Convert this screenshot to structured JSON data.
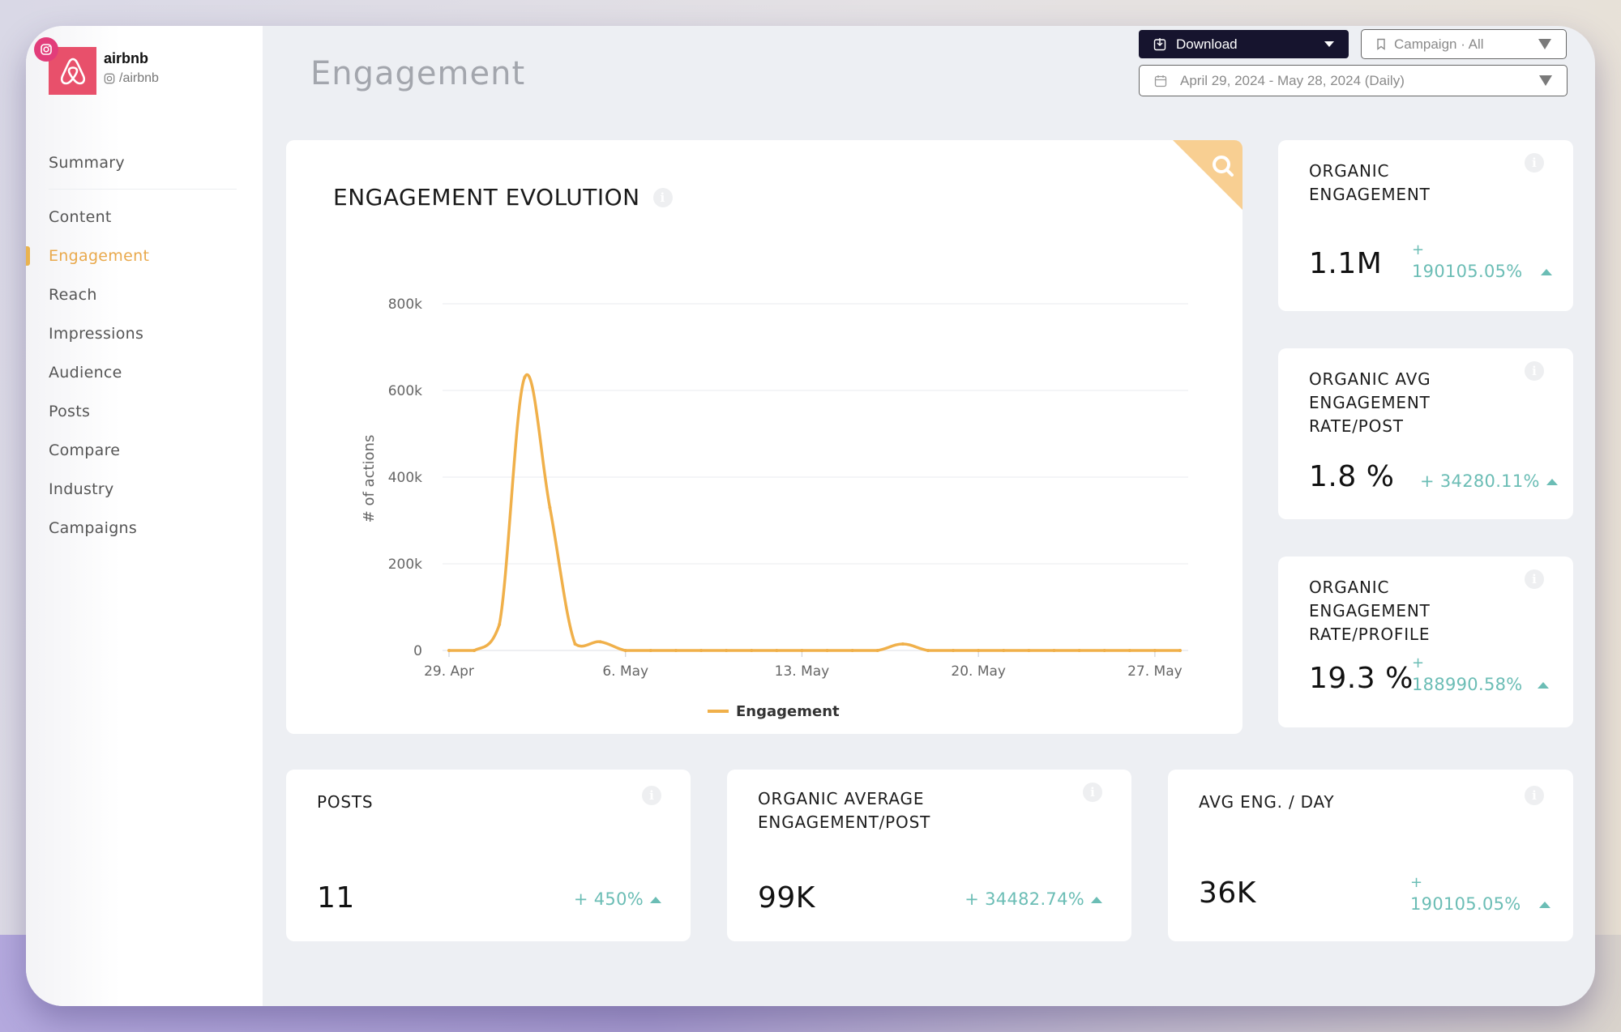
{
  "account": {
    "name": "airbnb",
    "handle": "/airbnb",
    "platform_icon": "instagram-icon",
    "brand_color": "#e8506b"
  },
  "sidebar": {
    "items": [
      {
        "label": "Summary",
        "active": false
      },
      {
        "label": "Content",
        "active": false
      },
      {
        "label": "Engagement",
        "active": true
      },
      {
        "label": "Reach",
        "active": false
      },
      {
        "label": "Impressions",
        "active": false
      },
      {
        "label": "Audience",
        "active": false
      },
      {
        "label": "Posts",
        "active": false
      },
      {
        "label": "Compare",
        "active": false
      },
      {
        "label": "Industry",
        "active": false
      },
      {
        "label": "Campaigns",
        "active": false
      }
    ]
  },
  "header": {
    "title": "Engagement",
    "download_label": "Download",
    "campaign_select": "Campaign · All",
    "date_range": "April 29, 2024 - May 28, 2024 (Daily)"
  },
  "chart_card": {
    "title": "ENGAGEMENT EVOLUTION"
  },
  "chart_data": {
    "type": "line",
    "title": "ENGAGEMENT EVOLUTION",
    "xlabel": "",
    "ylabel": "# of actions",
    "x": [
      "29 Apr",
      "30 Apr",
      "1 May",
      "2 May",
      "3 May",
      "4 May",
      "5 May",
      "6 May",
      "7 May",
      "8 May",
      "9 May",
      "10 May",
      "11 May",
      "12 May",
      "13 May",
      "14 May",
      "15 May",
      "16 May",
      "17 May",
      "18 May",
      "19 May",
      "20 May",
      "21 May",
      "22 May",
      "23 May",
      "24 May",
      "25 May",
      "26 May",
      "27 May",
      "28 May"
    ],
    "series": [
      {
        "name": "Engagement",
        "color": "#f0b04a",
        "values": [
          0,
          0,
          60000,
          630000,
          330000,
          15000,
          20000,
          0,
          0,
          0,
          0,
          0,
          0,
          0,
          0,
          0,
          0,
          0,
          15000,
          0,
          0,
          0,
          0,
          0,
          0,
          0,
          0,
          0,
          0,
          0
        ]
      }
    ],
    "x_tick_labels": [
      "29. Apr",
      "6. May",
      "13. May",
      "20. May",
      "27. May"
    ],
    "x_tick_index": [
      0,
      7,
      14,
      21,
      28
    ],
    "y_tick_labels": [
      "0",
      "200k",
      "400k",
      "600k",
      "800k"
    ],
    "y_ticks": [
      0,
      200000,
      400000,
      600000,
      800000
    ],
    "ylim": [
      0,
      800000
    ],
    "grid": true,
    "legend": "bottom-center"
  },
  "kpis_side": [
    {
      "title_lines": [
        "ORGANIC",
        "ENGAGEMENT"
      ],
      "value": "1.1M",
      "delta_sign": "+",
      "delta": "190105.05%",
      "wrap": true
    },
    {
      "title_lines": [
        "ORGANIC AVG",
        "ENGAGEMENT",
        "RATE/POST"
      ],
      "value": "1.8 %",
      "delta_sign": "+",
      "delta": "34280.11%",
      "wrap": false
    },
    {
      "title_lines": [
        "ORGANIC",
        "ENGAGEMENT",
        "RATE/PROFILE"
      ],
      "value": "19.3 %",
      "delta_sign": "+",
      "delta": "188990.58%",
      "wrap": true
    }
  ],
  "kpis_bottom": [
    {
      "title_lines": [
        "POSTS"
      ],
      "value": "11",
      "delta_sign": "+",
      "delta": "450%",
      "wrap": false
    },
    {
      "title_lines": [
        "ORGANIC AVERAGE",
        "ENGAGEMENT/POST"
      ],
      "value": "99K",
      "delta_sign": "+",
      "delta": "34482.74%",
      "wrap": false
    },
    {
      "title_lines": [
        "AVG ENG. / DAY"
      ],
      "value": "36K",
      "delta_sign": "+",
      "delta": "190105.05%",
      "wrap": true
    }
  ],
  "colors": {
    "accent": "#e9a94c",
    "positive": "#6bbdb5",
    "chart_line": "#f0b04a",
    "zoom_corner": "#f8cf92",
    "download_bg": "#16142e"
  }
}
